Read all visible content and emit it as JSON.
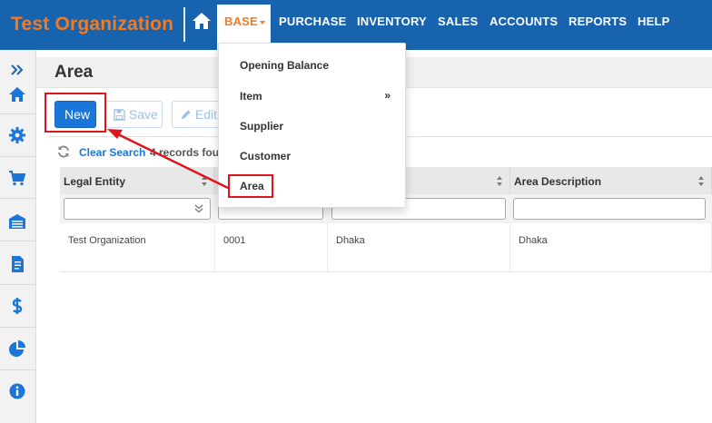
{
  "brand": {
    "name": "Test Organization",
    "color": "#f47a20"
  },
  "nav": {
    "home_icon": "home-icon",
    "items": [
      {
        "label": "BASE",
        "active": true
      },
      {
        "label": "PURCHASE"
      },
      {
        "label": "INVENTORY"
      },
      {
        "label": "SALES"
      },
      {
        "label": "ACCOUNTS"
      },
      {
        "label": "REPORTS"
      },
      {
        "label": "HELP"
      }
    ]
  },
  "base_menu": {
    "items": [
      {
        "label": "Opening Balance"
      },
      {
        "label": "Item",
        "submenu_glyph": "»"
      },
      {
        "label": "Supplier"
      },
      {
        "label": "Customer"
      },
      {
        "label": "Area",
        "highlighted": true
      }
    ]
  },
  "sidebar": {
    "icons": [
      "expand-icon",
      "home-icon",
      "gear-icon",
      "cart-icon",
      "warehouse-icon",
      "invoice-icon",
      "dollar-icon",
      "pie-chart-icon",
      "info-icon"
    ]
  },
  "page": {
    "title": "Area",
    "buttons": {
      "new": "New",
      "save": "Save",
      "edit": "Edit"
    },
    "clear_search": "Clear Search",
    "records": "4 records fou"
  },
  "table": {
    "columns": [
      "Legal Entity",
      "",
      "",
      "Area Description"
    ],
    "rows": [
      [
        "Test Organization",
        "0001",
        "Dhaka",
        "Dhaka"
      ]
    ]
  },
  "colors": {
    "topbar": "#1863ad",
    "accent": "#f47a20",
    "primary": "#1a76d8",
    "annotation": "#e0141c"
  }
}
